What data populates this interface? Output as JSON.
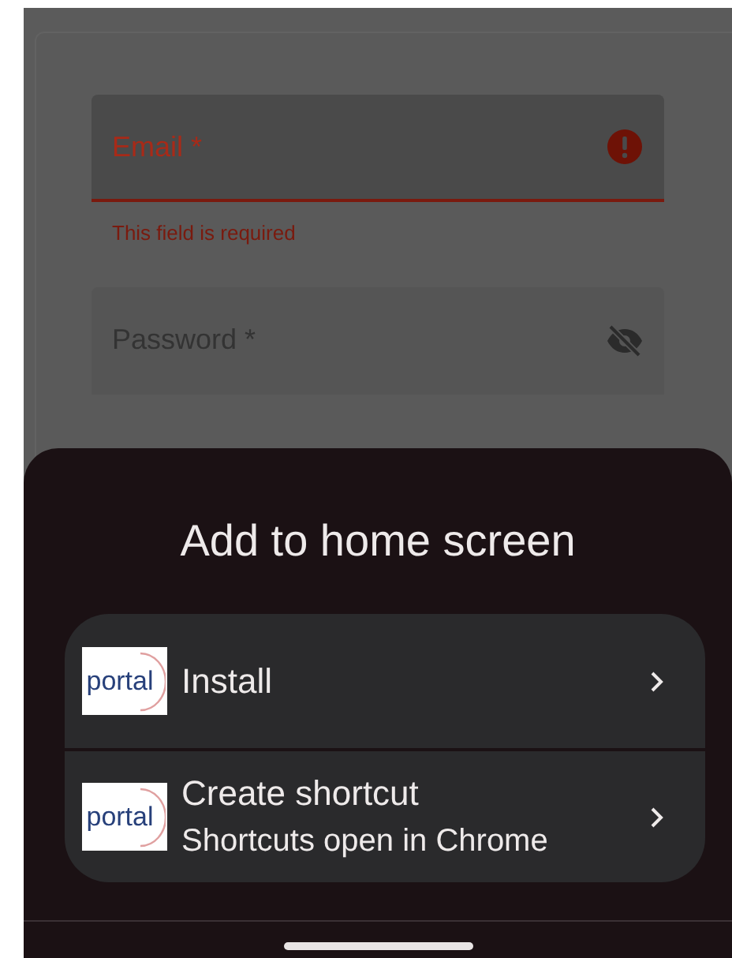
{
  "form": {
    "fields": [
      {
        "label": "Email *",
        "error": true,
        "error_text": "This field is required"
      },
      {
        "label": "Password *",
        "error": false
      }
    ]
  },
  "sheet": {
    "title": "Add to home screen",
    "options": [
      {
        "logo_text": "portal",
        "title": "Install"
      },
      {
        "logo_text": "portal",
        "title": "Create shortcut",
        "subtitle": "Shortcuts open in Chrome"
      }
    ]
  }
}
